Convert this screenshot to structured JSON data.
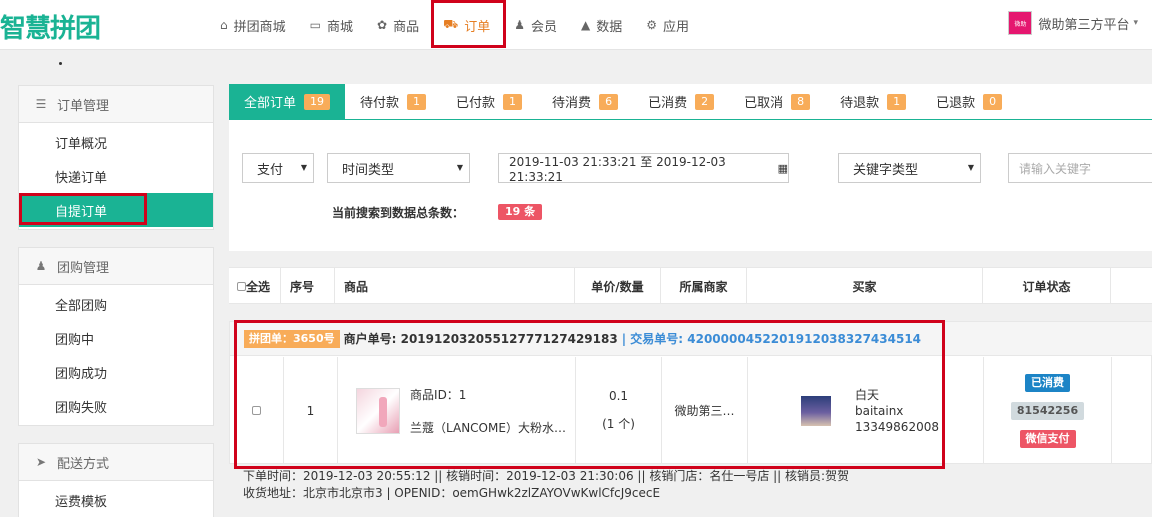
{
  "brand": {
    "logo": "智慧拼团"
  },
  "nav": {
    "items": [
      {
        "icon": "home-icon",
        "glyph": "⌂",
        "label": "拼团商城"
      },
      {
        "icon": "monitor-icon",
        "glyph": "▭",
        "label": "商城"
      },
      {
        "icon": "gift-icon",
        "glyph": "✿",
        "label": "商品"
      },
      {
        "icon": "cart-icon",
        "glyph": "⛟",
        "label": "订单"
      },
      {
        "icon": "user-icon",
        "glyph": "♟",
        "label": "会员"
      },
      {
        "icon": "chart-icon",
        "glyph": "▲",
        "label": "数据"
      },
      {
        "icon": "cogs-icon",
        "glyph": "⚙",
        "label": "应用"
      }
    ],
    "active_index": 3
  },
  "user": {
    "name": "微助第三方平台",
    "avatar_text": "微助"
  },
  "sidebar": {
    "groups": [
      {
        "icon": "list-icon",
        "glyph": "☰",
        "title": "订单管理",
        "items": [
          "订单概况",
          "快递订单",
          "自提订单"
        ]
      },
      {
        "icon": "users-icon",
        "glyph": "♟",
        "title": "团购管理",
        "items": [
          "全部团购",
          "团购中",
          "团购成功",
          "团购失败"
        ]
      },
      {
        "icon": "send-icon",
        "glyph": "➤",
        "title": "配送方式",
        "items": [
          "运费模板"
        ]
      }
    ],
    "active_item": "自提订单"
  },
  "tabs": [
    {
      "label": "全部订单",
      "count": "19"
    },
    {
      "label": "待付款",
      "count": "1"
    },
    {
      "label": "已付款",
      "count": "1"
    },
    {
      "label": "待消费",
      "count": "6"
    },
    {
      "label": "已消费",
      "count": "2"
    },
    {
      "label": "已取消",
      "count": "8"
    },
    {
      "label": "待退款",
      "count": "1"
    },
    {
      "label": "已退款",
      "count": "0"
    }
  ],
  "filters": {
    "pay": "支付",
    "time_type": "时间类型",
    "date_range": "2019-11-03 21:33:21 至 2019-12-03 21:33:21",
    "keyword_type": "关键字类型",
    "keyword_placeholder": "请输入关键字",
    "total_label": "当前搜索到数据总条数：",
    "total_count": "19 条"
  },
  "table": {
    "headers": {
      "select_all": "全选",
      "index": "序号",
      "product": "商品",
      "price_qty": "单价/数量",
      "merchant": "所属商家",
      "buyer": "买家",
      "status": "订单状态"
    }
  },
  "order": {
    "group_tag": "拼团单：3650号",
    "merchant_no": "商户单号: 20191203205512777127429183",
    "trade_no": "| 交易单号: 4200000452201912038327434514",
    "index": "1",
    "product_id": "商品ID：1",
    "product_name": "兰蔻（LANCOME）大粉水…",
    "price": "0.1",
    "qty": "(1 个)",
    "merchant": "微助第三…",
    "buyer_name": "白天",
    "buyer_account": "baitainx",
    "buyer_phone": "13349862008",
    "status": "已消费",
    "verify_code": "81542256",
    "pay_method": "微信支付",
    "footer_line1": "下单时间：2019-12-03 20:55:12 || 核销时间：2019-12-03 21:30:06 || 核销门店：名仕一号店 || 核销员:贺贺",
    "footer_line2": "收货地址：北京市北京市3 | OPENID：oemGHwk2zlZAYOVwKwlCfcJ9cecE"
  }
}
